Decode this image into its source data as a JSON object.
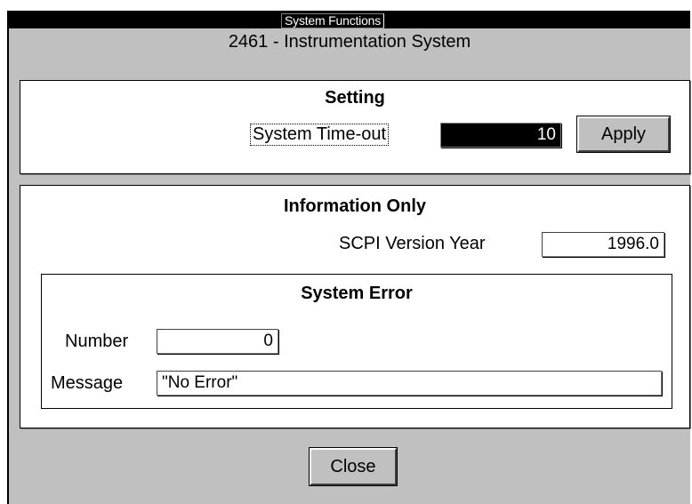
{
  "window": {
    "title": "System Functions",
    "subtitle": "2461 - Instrumentation System"
  },
  "setting": {
    "heading": "Setting",
    "timeout_label": "System Time-out",
    "timeout_value": "10",
    "apply_label": "Apply"
  },
  "info": {
    "heading": "Information Only",
    "scpi_label": "SCPI Version Year",
    "scpi_value": "1996.0"
  },
  "error": {
    "heading": "System Error",
    "number_label": "Number",
    "number_value": "0",
    "message_label": "Message",
    "message_value": "\"No Error\""
  },
  "footer": {
    "close_label": "Close"
  }
}
